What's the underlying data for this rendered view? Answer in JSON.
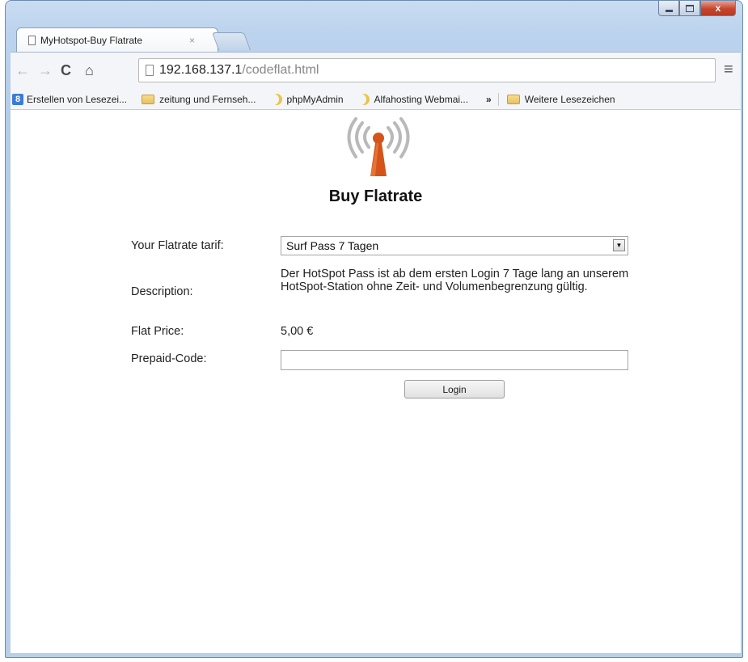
{
  "tab": {
    "title": "MyHotspot-Buy Flatrate",
    "close": "×"
  },
  "toolbar": {
    "url_host": "192.168.137.1",
    "url_path": "/codeflat.html"
  },
  "bookmarks": [
    {
      "label": "Erstellen von Lesezei...",
      "icon": "google-bookmark-icon"
    },
    {
      "label": "zeitung und Fernseh...",
      "icon": "folder-icon"
    },
    {
      "label": "phpMyAdmin",
      "icon": "moon-icon"
    },
    {
      "label": "Alfahosting Webmai...",
      "icon": "moon-icon"
    }
  ],
  "bookmarks_overflow": "»",
  "other_bookmarks": "Weitere Lesezeichen",
  "page": {
    "title": "Buy Flatrate",
    "tarif_label": "Your Flatrate tarif:",
    "tarif_value": "Surf Pass 7 Tagen",
    "description_label": "Description:",
    "description_text": "Der HotSpot Pass ist ab dem ersten Login 7 Tage lang an unserem HotSpot-Station ohne Zeit- und Volumenbegrenzung gültig.",
    "price_label": "Flat Price:",
    "price_value": "5,00 €",
    "code_label": "Prepaid-Code:",
    "code_value": "",
    "login_label": "Login"
  },
  "colors": {
    "logo_orange": "#d4541a",
    "window_frame": "#bcd3ee",
    "close_button": "#c7442c"
  }
}
